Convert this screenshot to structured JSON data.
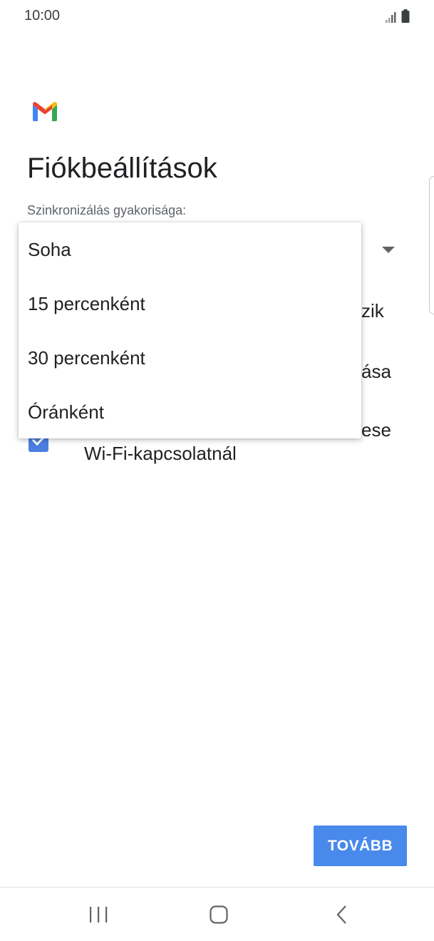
{
  "status_bar": {
    "time": "10:00"
  },
  "header": {
    "app_icon": "gmail-icon",
    "title": "Fiókbeállítások"
  },
  "sync": {
    "label": "Szinkronizálás gyakorisága:",
    "selected_value": "Soha",
    "options": [
      "Soha",
      "15 percenként",
      "30 percenként",
      "Óránként"
    ]
  },
  "background_options": {
    "partial_1": "zik",
    "partial_2": "ása",
    "partial_3": "ese",
    "wifi_checkbox_label": "Wi-Fi-kapcsolatnál",
    "wifi_checked": true
  },
  "actions": {
    "next_label": "TOVÁBB"
  },
  "colors": {
    "accent": "#4a89ec",
    "checkbox": "#4a7fe0"
  },
  "nav": {
    "recents": "recents-icon",
    "home": "home-icon",
    "back": "back-icon"
  }
}
